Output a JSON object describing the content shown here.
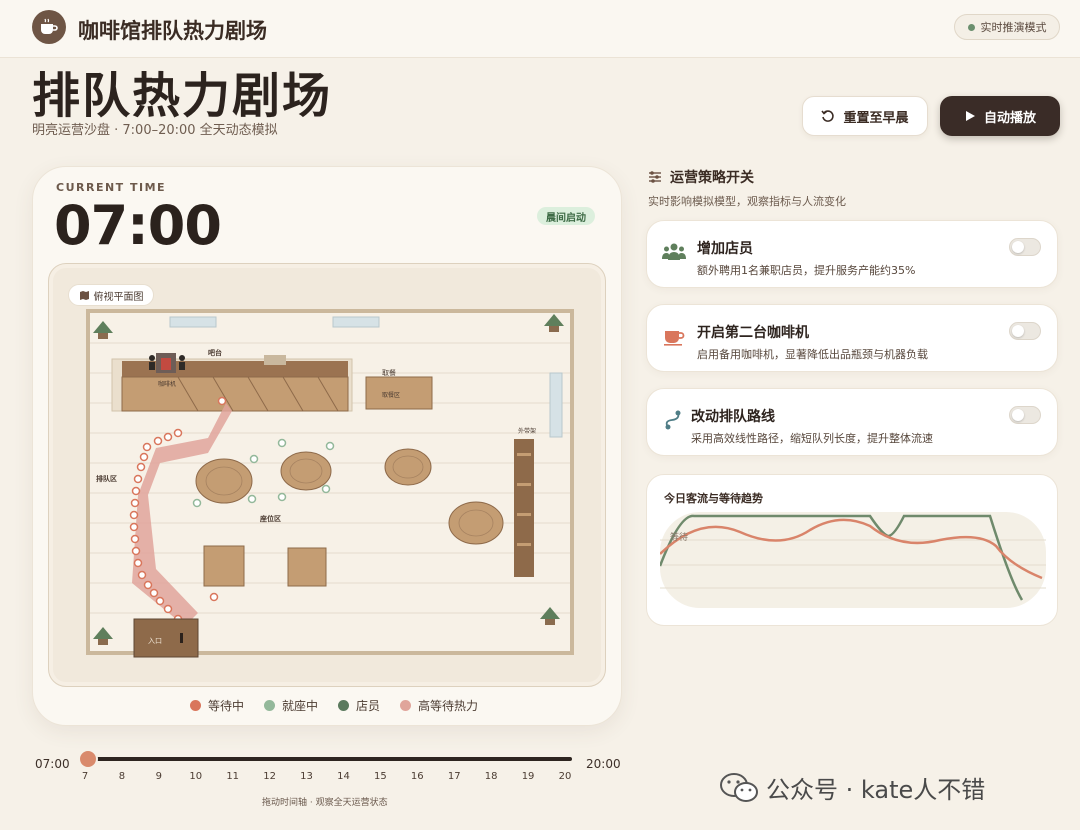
{
  "app": {
    "title": "咖啡馆排队热力剧场",
    "mode": "实时推演模式"
  },
  "page": {
    "title": "排队热力剧场",
    "subtitle": "明亮运营沙盘 · 7:00–20:00 全天动态模拟"
  },
  "actions": {
    "reset_label": "重置至早晨",
    "play_label": "自动播放"
  },
  "sim": {
    "time_label": "CURRENT TIME",
    "time": "07:00",
    "phase": "晨间启动",
    "view_label": "俯视平面图",
    "map_labels": {
      "bar": "吧台",
      "machine": "咖啡机",
      "pickup": "取餐",
      "pickup_area": "取餐区",
      "queue_area": "排队区",
      "seating": "座位区",
      "takeaway": "外带架",
      "entrance": "入口"
    },
    "legend": [
      {
        "label": "等待中",
        "color": "#d9765c"
      },
      {
        "label": "就座中",
        "color": "#93b89a"
      },
      {
        "label": "店员",
        "color": "#5b7a5e"
      },
      {
        "label": "高等待热力",
        "color": "#e0a59b"
      }
    ]
  },
  "timeline": {
    "start": "07:00",
    "end": "20:00",
    "ticks": [
      "7",
      "8",
      "9",
      "10",
      "11",
      "12",
      "13",
      "14",
      "15",
      "16",
      "17",
      "18",
      "19",
      "20"
    ],
    "hint": "拖动时间轴 · 观察全天运营状态",
    "progress": 0
  },
  "strategy": {
    "title": "运营策略开关",
    "subtitle": "实时影响模拟模型，观察指标与人流变化",
    "options": [
      {
        "title": "增加店员",
        "desc": "额外聘用1名兼职店员，提升服务产能约35%",
        "icon": "staff-icon",
        "enabled": false
      },
      {
        "title": "开启第二台咖啡机",
        "desc": "启用备用咖啡机，显著降低出品瓶颈与机器负载",
        "icon": "coffee-cup-icon",
        "enabled": false
      },
      {
        "title": "改动排队路线",
        "desc": "采用高效线性路径，缩短队列长度，提升整体流速",
        "icon": "route-icon",
        "enabled": false
      }
    ]
  },
  "trend": {
    "title": "今日客流与等待趋势",
    "series_label": "等待",
    "colors": {
      "flow": "#6f8a6c",
      "wait": "#d9846a"
    }
  },
  "watermark": "公众号 · kate人不错"
}
